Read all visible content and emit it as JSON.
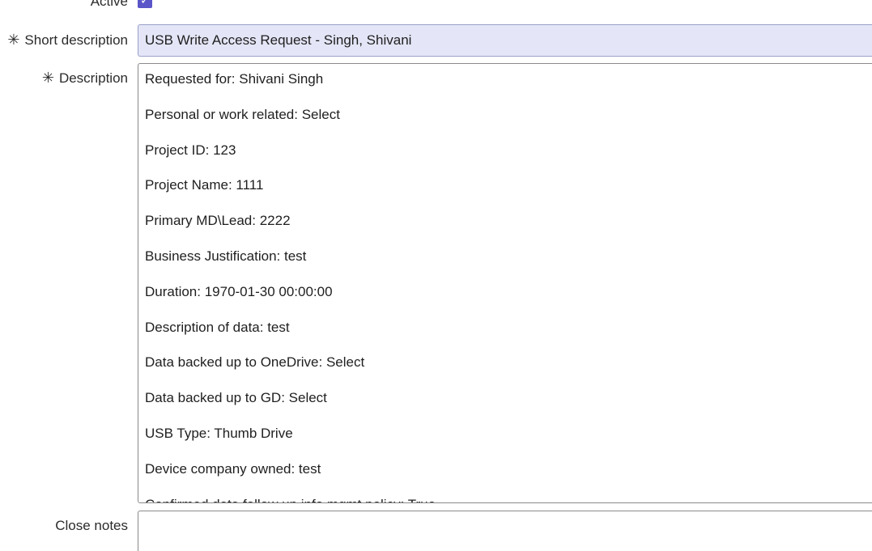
{
  "active": {
    "label": "Active",
    "checked": true
  },
  "short_description": {
    "label": "Short description",
    "required_marker": "✳",
    "value": "USB Write Access Request - Singh, Shivani"
  },
  "description": {
    "label": "Description",
    "required_marker": "✳",
    "lines": [
      "Requested for: Shivani Singh",
      "Personal or work related: Select",
      "Project ID: 123",
      "Project Name: 1111",
      "Primary MD\\Lead: 2222",
      "Business Justification: test",
      "Duration: 1970-01-30 00:00:00",
      "Description of data: test",
      "Data backed up to OneDrive: Select",
      "Data backed up to GD: Select",
      "USB Type: Thumb Drive",
      "Device company owned: test",
      "Confirmed data follow up info mgmt policy: True"
    ]
  },
  "close_notes": {
    "label": "Close notes",
    "value": ""
  },
  "colors": {
    "checkbox": "#5a55c8",
    "short_description_bg": "#e4e6f7"
  }
}
